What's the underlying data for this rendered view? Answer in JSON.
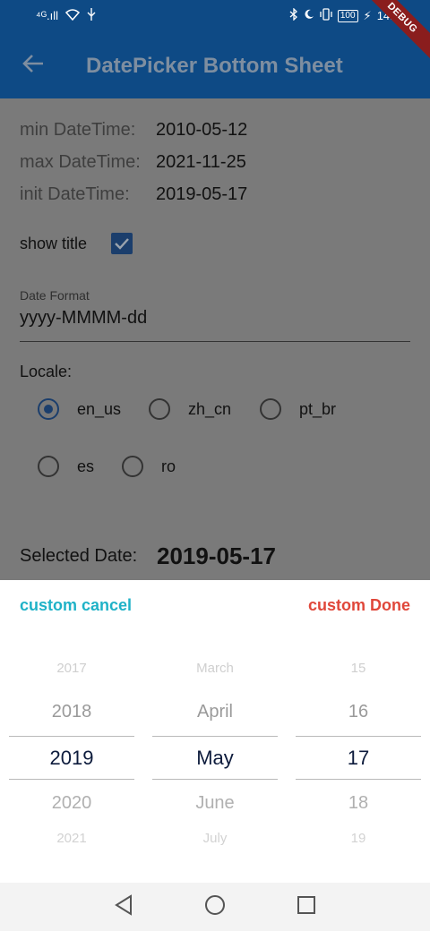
{
  "status_bar": {
    "signal": "⁴ᴳ.ıll",
    "wifi_icon": "wifi-icon",
    "usb_icon": "usb-icon",
    "bluetooth_icon": "bluetooth-icon",
    "moon_icon": "moon-icon",
    "vibrate_icon": "vibrate-icon",
    "battery": "100",
    "time": "14:0"
  },
  "debug_banner": "DEBUG",
  "app_bar": {
    "back_icon": "arrow-back-icon",
    "title": "DatePicker Bottom Sheet"
  },
  "info": {
    "min_label": "min DateTime:",
    "min_value": "2010-05-12",
    "max_label": "max DateTime:",
    "max_value": "2021-11-25",
    "init_label": "init DateTime:",
    "init_value": "2019-05-17"
  },
  "show_title": {
    "label": "show title",
    "checked": true
  },
  "date_format": {
    "label": "Date Format",
    "value": "yyyy-MMMM-dd"
  },
  "locale": {
    "label": "Locale:",
    "options": [
      "en_us",
      "zh_cn",
      "pt_br",
      "es",
      "ro"
    ],
    "selected": "en_us"
  },
  "selected_date": {
    "label": "Selected Date:",
    "value": "2019-05-17"
  },
  "sheet": {
    "cancel_label": "custom cancel",
    "done_label": "custom Done",
    "year_column": [
      "2017",
      "2018",
      "2019",
      "2020",
      "2021"
    ],
    "month_column": [
      "March",
      "April",
      "May",
      "June",
      "July"
    ],
    "day_column": [
      "15",
      "16",
      "17",
      "18",
      "19"
    ],
    "selected_index": 2,
    "colors": {
      "cancel": "#1fb2c7",
      "done": "#e0473a",
      "selected_text": "#0d1b3c"
    }
  },
  "nav_bar": {
    "back_icon": "nav-back-icon",
    "home_icon": "nav-home-icon",
    "recents_icon": "nav-recents-icon"
  },
  "colors": {
    "primary": "#0e4a85",
    "checkbox": "#1b3e6c",
    "scrim": "#7a7a7a"
  }
}
